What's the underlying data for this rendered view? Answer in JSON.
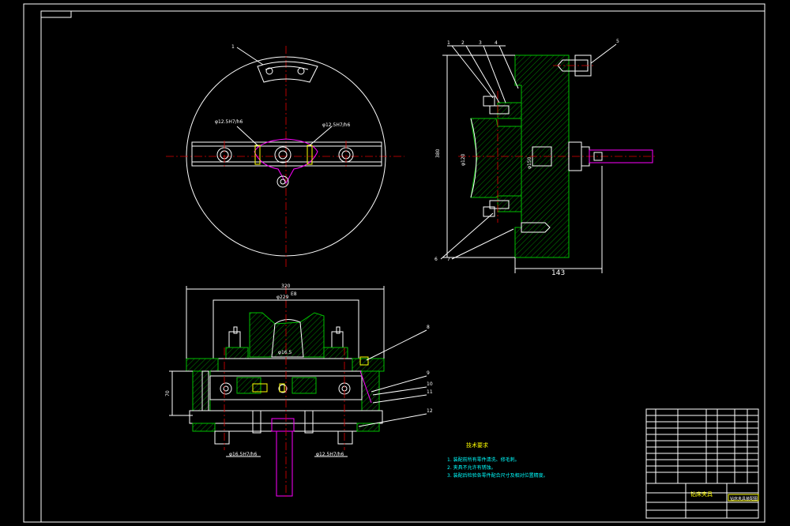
{
  "colors": {
    "background": "#000000",
    "outline": "#ffffff",
    "part": "#00c000",
    "center": "#e00000",
    "note": "#ffff00",
    "link": "#ff00ff"
  },
  "dims": {
    "plan_left_bore": "φ12.5H7/h6",
    "plan_right_bore": "φ12.5H7/h6",
    "side_height": "380",
    "side_inner": "φ120",
    "side_inner_b": "φ150",
    "side_depth": "143",
    "front_width": "320",
    "front_span": "φ229",
    "front_top_mark": "E8",
    "front_pin": "φ16.5",
    "front_height": "70",
    "front_left_fit": "φ16.5H7/h6",
    "front_right_fit": "φ12.5H7/h6"
  },
  "notes": {
    "heading": "技术要求",
    "items": [
      "1. 装配前所有零件清洗、修毛刺。",
      "2. 夹具不允许有锈蚀。",
      "3. 装配后检验各零件配合尺寸及相对位置精度。"
    ]
  },
  "title_block": {
    "name": "钻床夹具",
    "drawing": "钻床夹具装配图"
  }
}
